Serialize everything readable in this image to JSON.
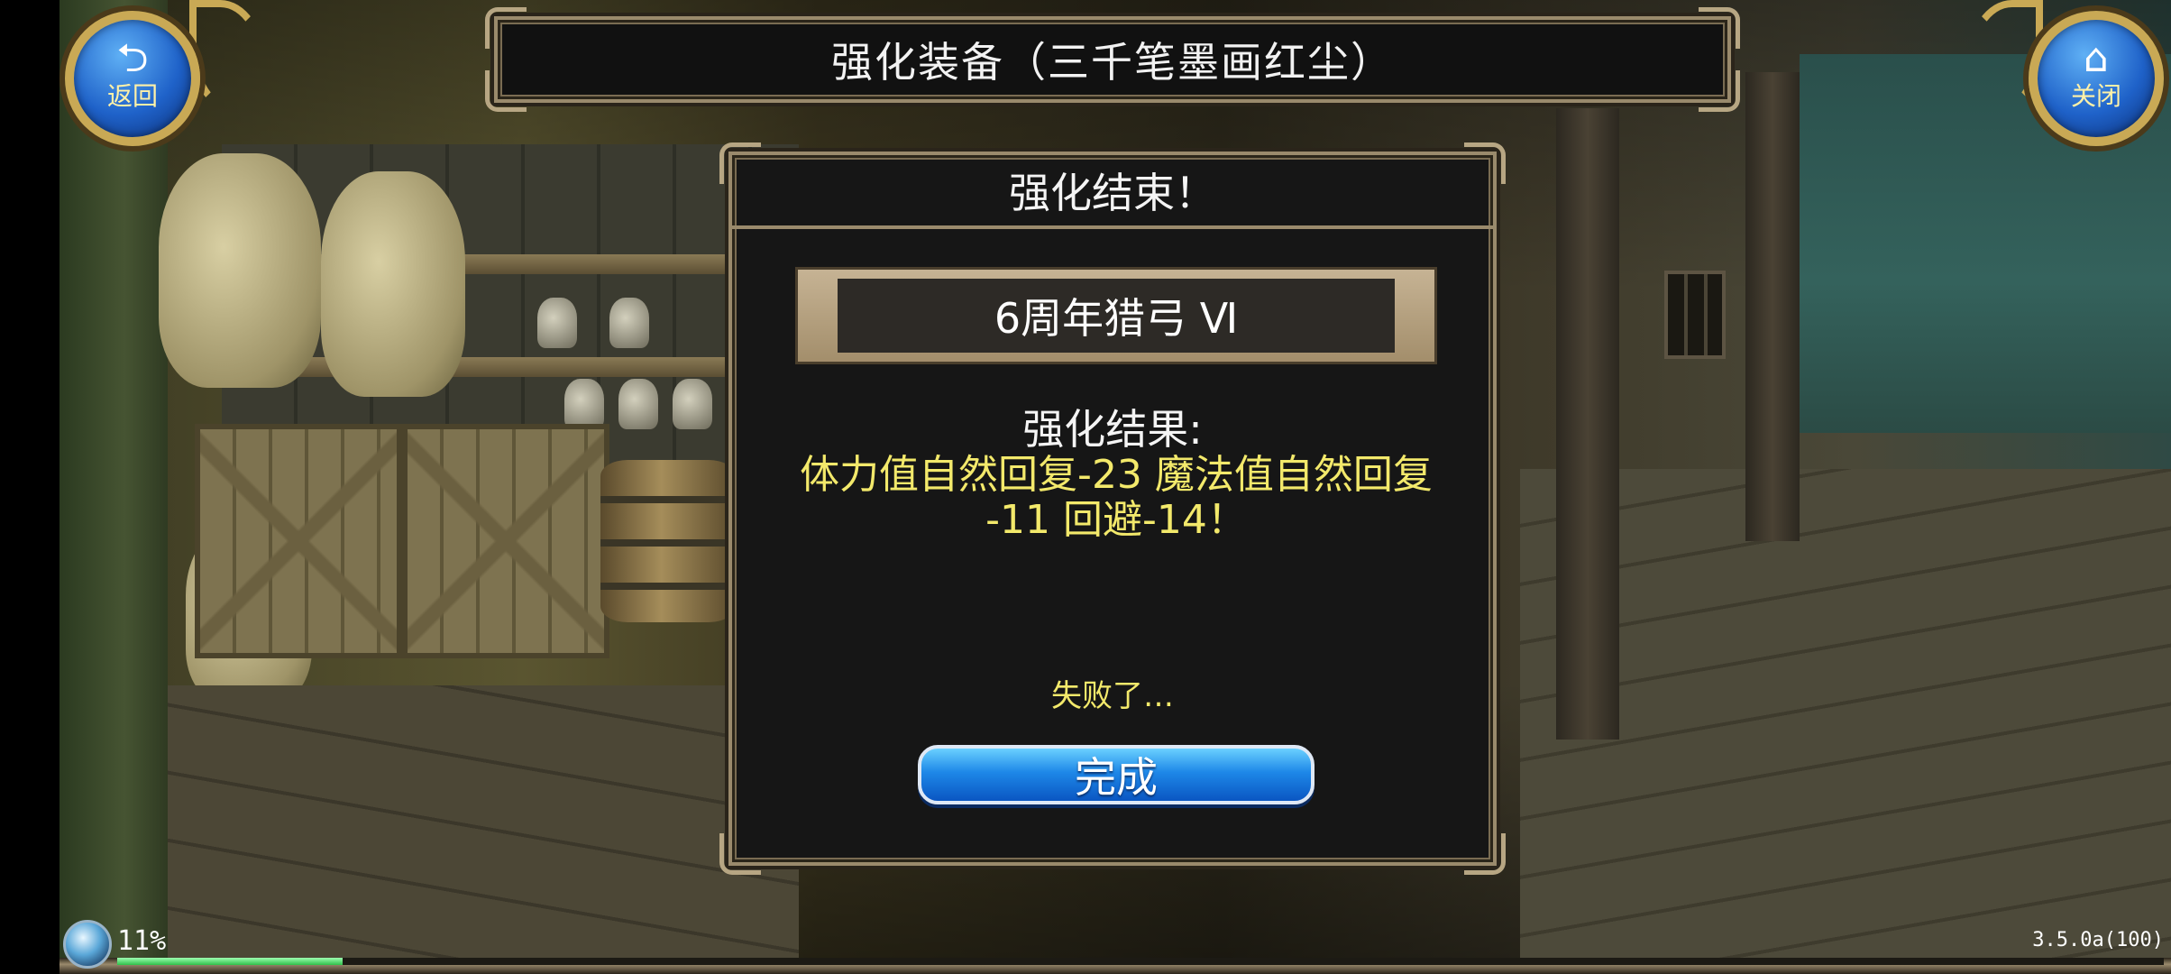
{
  "header": {
    "title": "强化装备（三千笔墨画红尘）"
  },
  "nav": {
    "back_label": "返回",
    "back_icon": "return-arrow-icon",
    "close_label": "关闭",
    "close_icon": "home-icon"
  },
  "dialog": {
    "header": "强化结束！",
    "item_name": "6周年猎弓 Ⅵ",
    "result_label": "强化结果:",
    "result_line1": "体力值自然回复-23 魔法值自然回复",
    "result_line2": "-11 回避-14！",
    "fail_text": "失败了…",
    "done_label": "完成"
  },
  "status": {
    "progress_text": "11%",
    "progress_value": 0.11,
    "version": "3.5.0a(100)"
  },
  "colors": {
    "highlight_text": "#f3e96b",
    "button_blue": "#1e88e8",
    "frame_gold": "#9a8a6c"
  }
}
